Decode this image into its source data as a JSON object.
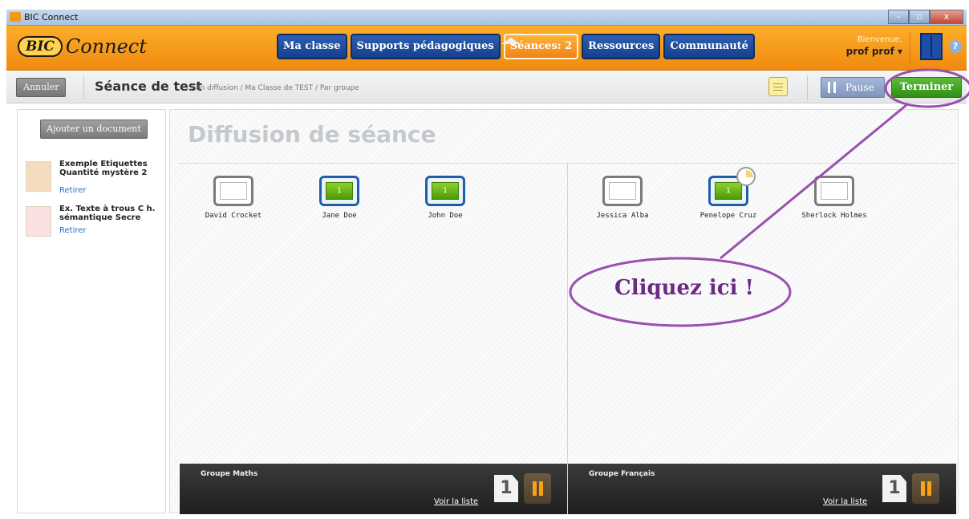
{
  "window": {
    "title": "BIC Connect",
    "controls": [
      "–",
      "▫",
      "x"
    ]
  },
  "header": {
    "logo_brand": "BIC",
    "logo_product": "Connect",
    "nav": [
      "Ma classe",
      "Supports pédagogiques",
      "Séances: 2",
      "Ressources",
      "Communauté"
    ],
    "active_tab": "Séances: 2",
    "welcome": "Bienvenue,",
    "user": "prof prof ▾",
    "help": "?"
  },
  "actionbar": {
    "cancel": "Annuler",
    "session_title": "Séance de test",
    "breadcrumb": "/ En diffusion / Ma Classe de TEST / Par groupe",
    "pause": "Pause",
    "finish": "Terminer"
  },
  "sidebar": {
    "add_document": "Ajouter un document",
    "documents": [
      {
        "title": "Exemple Etiquettes Quantité mystère 2",
        "remove": "Retirer"
      },
      {
        "title": "Ex. Texte à trous C h. sémantique Secre",
        "remove": "Retirer"
      }
    ]
  },
  "main": {
    "title": "Diffusion de séance",
    "groups": [
      {
        "name": "Groupe Maths",
        "link": "Voir la liste",
        "count": "1",
        "students": [
          {
            "name": "David Crocket",
            "active": false,
            "badge": ""
          },
          {
            "name": "Jane Doe",
            "active": true,
            "badge": "1"
          },
          {
            "name": "John Doe",
            "active": true,
            "badge": "1"
          }
        ]
      },
      {
        "name": "Groupe Français",
        "link": "Voir la liste",
        "count": "1",
        "students": [
          {
            "name": "Jessica Alba",
            "active": false,
            "badge": ""
          },
          {
            "name": "Penelope Cruz",
            "active": true,
            "badge": "1",
            "timer": true
          },
          {
            "name": "Sherlock Holmes",
            "active": false,
            "badge": ""
          }
        ]
      }
    ]
  },
  "annotation": {
    "callout": "Cliquez ici !",
    "color": "#9b4fae"
  },
  "colors": {
    "header_orange": "#f59a1b",
    "nav_blue": "#1f4f9f",
    "finish_green": "#3a9b1e"
  }
}
